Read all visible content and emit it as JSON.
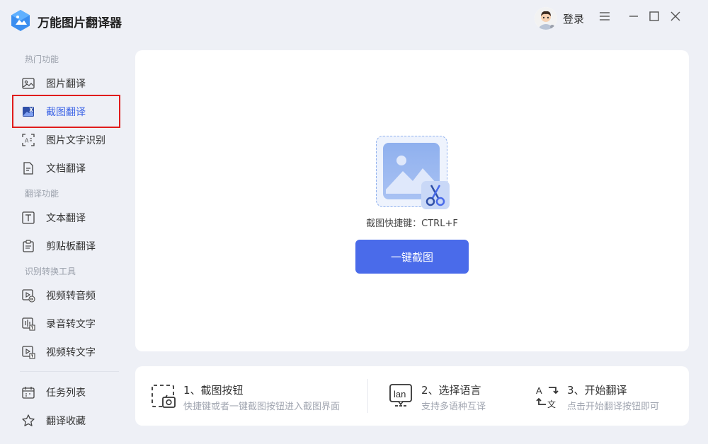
{
  "app": {
    "title": "万能图片翻译器",
    "login_label": "登录"
  },
  "sidebar": {
    "sections": [
      {
        "label": "热门功能"
      },
      {
        "label": "翻译功能"
      },
      {
        "label": "识别转换工具"
      }
    ],
    "items": [
      {
        "label": "图片翻译",
        "icon": "image-icon"
      },
      {
        "label": "截图翻译",
        "icon": "screenshot-icon",
        "active": true
      },
      {
        "label": "图片文字识别",
        "icon": "ocr-icon"
      },
      {
        "label": "文档翻译",
        "icon": "document-icon"
      },
      {
        "label": "文本翻译",
        "icon": "text-icon"
      },
      {
        "label": "剪贴板翻译",
        "icon": "clipboard-icon"
      },
      {
        "label": "视频转音频",
        "icon": "video-audio-icon"
      },
      {
        "label": "录音转文字",
        "icon": "recording-icon"
      },
      {
        "label": "视频转文字",
        "icon": "video-text-icon"
      },
      {
        "label": "任务列表",
        "icon": "calendar-icon"
      },
      {
        "label": "翻译收藏",
        "icon": "star-icon"
      }
    ]
  },
  "main": {
    "shortcut_text": "截图快捷键：CTRL+F",
    "capture_button": "一键截图"
  },
  "steps": [
    {
      "title": "1、截图按钮",
      "desc": "快捷键或者一键截图按钮进入截图界面"
    },
    {
      "title": "2、选择语言",
      "desc": "支持多语种互译"
    },
    {
      "title": "3、开始翻译",
      "desc": "点击开始翻译按钮即可"
    }
  ],
  "colors": {
    "accent": "#4a6bea",
    "active_text": "#3b63e6",
    "highlight_border": "#e01c1c",
    "background": "#eef0f6"
  }
}
